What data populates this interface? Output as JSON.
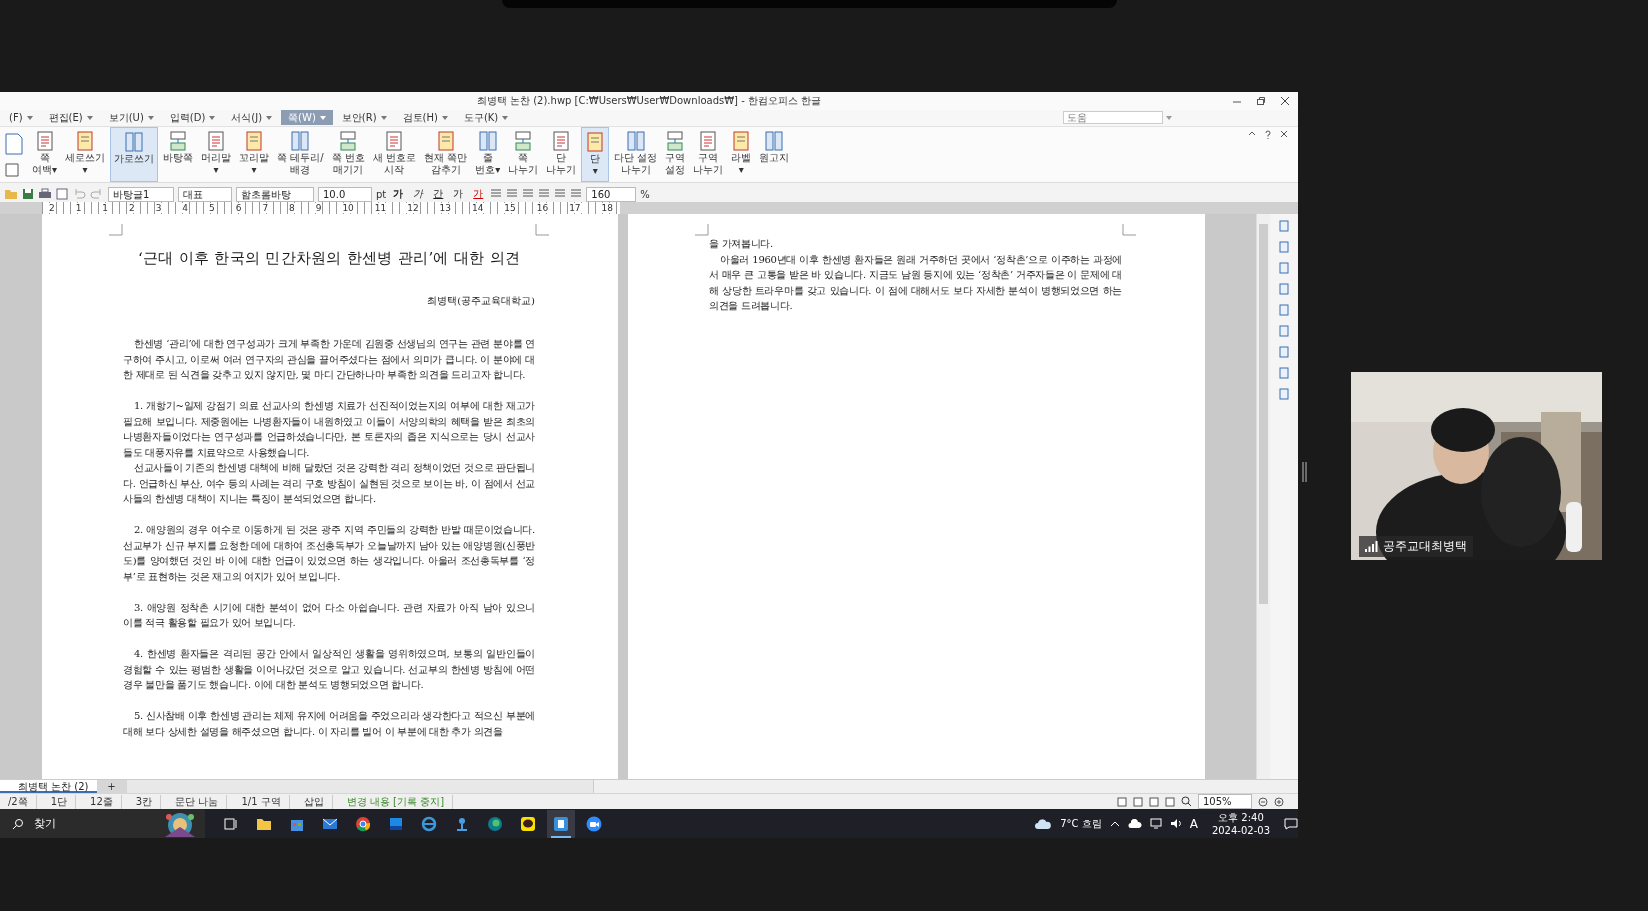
{
  "title_bar": {
    "title": "최병택 논찬 (2).hwp [C:₩Users₩User₩Downloads₩] - 한컴오피스 한글"
  },
  "menus": [
    {
      "label": "(F)",
      "selected": false
    },
    {
      "label": "편집(E)",
      "selected": false
    },
    {
      "label": "보기(U)",
      "selected": false
    },
    {
      "label": "입력(D)",
      "selected": false
    },
    {
      "label": "서식(J)",
      "selected": false
    },
    {
      "label": "쪽(W)",
      "selected": true
    },
    {
      "label": "보안(R)",
      "selected": false
    },
    {
      "label": "검토(H)",
      "selected": false
    },
    {
      "label": "도구(K)",
      "selected": false
    }
  ],
  "help_search": {
    "placeholder": "도움"
  },
  "ribbon": [
    {
      "label": "쪽\n여백▾",
      "selected": false
    },
    {
      "label": "세로쓰기\n▾",
      "selected": false
    },
    {
      "label": "가로쓰기",
      "selected": true
    },
    {
      "label": "바탕쪽",
      "selected": false
    },
    {
      "label": "머리말\n▾",
      "selected": false
    },
    {
      "label": "꼬리말\n▾",
      "selected": false
    },
    {
      "label": "쪽 테두리/\n배경",
      "selected": false
    },
    {
      "label": "쪽 번호\n매기기",
      "selected": false
    },
    {
      "label": "새 번호로\n시작",
      "selected": false
    },
    {
      "label": "현재 쪽만\n감추기",
      "selected": false
    },
    {
      "label": "줄\n번호▾",
      "selected": false
    },
    {
      "label": "쪽\n나누기",
      "selected": false
    },
    {
      "label": "단\n나누기",
      "selected": false
    },
    {
      "label": "단\n▾",
      "selected": true
    },
    {
      "label": "다단 설정\n나누기",
      "selected": false
    },
    {
      "label": "구역\n설정",
      "selected": false
    },
    {
      "label": "구역\n나누기",
      "selected": false
    },
    {
      "label": "라벨\n▾",
      "selected": false
    },
    {
      "label": "원고지",
      "selected": false
    }
  ],
  "format_toolbar": {
    "style": "바탕글1",
    "language": "대표",
    "font": "함초롬바탕",
    "size": "10.0",
    "unit": "pt",
    "char_buttons": [
      "가",
      "가",
      "간",
      "가",
      "가"
    ],
    "zoom": "160",
    "zoom_unit": "%"
  },
  "ruler": [
    "2",
    "1",
    "1",
    "2",
    "3",
    "4",
    "5",
    "6",
    "7",
    "8",
    "9",
    "10",
    "11",
    "12",
    "13",
    "14",
    "15",
    "16",
    "17",
    "18"
  ],
  "left_page": {
    "title": "‘근대 이후 한국의 민간차원의 한센병 관리’에 대한 의견",
    "author": "최병택(공주교육대학교)",
    "paragraphs": [
      {
        "kind": "section",
        "text": "한센병 ‘관리’에 대한 연구성과가 크게 부족한 가운데 김원중 선생님의 연구는 관련 분야를 연구하여 주시고, 이로써 여러 연구자의 관심을 끌어주셨다는 점에서 의미가 큽니다. 이 분야에 대한 제대로 된 식견을 갖추고 있지 않지만, 몇 마디 간단하나마 부족한 의견을 드리고자 합니다."
      },
      {
        "kind": "section",
        "text": "1. 개항기~일제 강점기 의료 선교사의 한센병 치료가 선진적이었는지의 여부에 대한 재고가 필요해 보입니다. 제중원에는 나병환자들이 내원하였고 이들이 서양의학의 혜택을 받은 최초의 나병환자들이었다는 연구성과를 언급하셨습니다만, 본 토론자의 좁은 지식으로는 당시 선교사들도 대풍자유를 치료약으로 사용했습니다."
      },
      {
        "kind": "paragraph",
        "text": "선교사들이 기존의 한센병 대책에 비해 달랐던 것은 강력한 격리 정책이었던 것으로 판단됩니다. 언급하신 부산, 여수 등의 사례는 격리 구호 방침이 실현된 것으로 보이는 바, 이 점에서 선교사들의 한센병 대책이 지니는 특징이 분석되었으면 합니다."
      },
      {
        "kind": "section",
        "text": "2. 애양원의 경우 여수로 이동하게 된 것은 광주 지역 주민들의 강력한 반발 때문이었습니다. 선교부가 신규 부지를 요청한 데에 대하여 조선총독부가 오늘날까지 남아 있는 애양병원(신풍반도)를 양여했던 것인 바 이에 대한 언급이 있었으면 하는 생각입니다. 아울러 조선총독부를 ‘정부’로 표현하는 것은 재고의 여지가 있어 보입니다."
      },
      {
        "kind": "section",
        "text": "3. 애양원 정착촌 시기에 대한 분석이 없어 다소 아쉽습니다. 관련 자료가 아직 남아 있으니 이를 적극 활용할 필요가 있어 보입니다."
      },
      {
        "kind": "section",
        "text": "4. 한센병 환자들은 격리된 공간 안에서 일상적인 생활을 영위하였으며, 보통의 일반인들이 경험할 수 있는 평범한 생활을 이어나갔던 것으로 알고 있습니다. 선교부의 한센병 방침에 어떤 경우 불만을 품기도 했습니다. 이에 대한 분석도 병행되었으면 합니다."
      },
      {
        "kind": "section",
        "text": "5. 신사참배 이후 한센병 관리는 체제 유지에 어려움을 주었으리라 생각한다고 적으신 부분에 대해 보다 상세한 설명을 해주셨으면 합니다. 이 자리를 빌어 이 부분에 대한 추가 의견을"
      }
    ]
  },
  "right_page": {
    "paragraphs": [
      {
        "kind": "continuation",
        "text": "을 가져봅니다."
      },
      {
        "kind": "paragraph",
        "text": "아울러 1960년대 이후 한센병 환자들은 원래 거주하던 곳에서 ‘정착촌’으로 이주하는 과정에서 매우 큰 고통을 받은 바 있습니다. 지금도 남원 등지에 있는 ‘정착촌’ 거주자들은 이 문제에 대해 상당한 트라우마를 갖고 있습니다. 이 점에 대해서도 보다 자세한 분석이 병행되었으면 하는 의견을 드려봅니다."
      }
    ]
  },
  "tabs": [
    {
      "label": "최병택 논찬 (2)",
      "selected": true
    }
  ],
  "add_tab": "+",
  "status_bar": {
    "items": [
      "/2쪽",
      "1단",
      "12줄",
      "3칸",
      "문단 나눔",
      "1/1 구역",
      "삽입"
    ],
    "change_tracking": "변경 내용 [기록 중지]",
    "zoom": "105%"
  },
  "taskbar": {
    "search": "찾기",
    "weather": "7°C 흐림",
    "input_mode": "A",
    "time": "오후 2:40",
    "date": "2024-02-03"
  },
  "video": {
    "name": "공주교대최병택"
  }
}
